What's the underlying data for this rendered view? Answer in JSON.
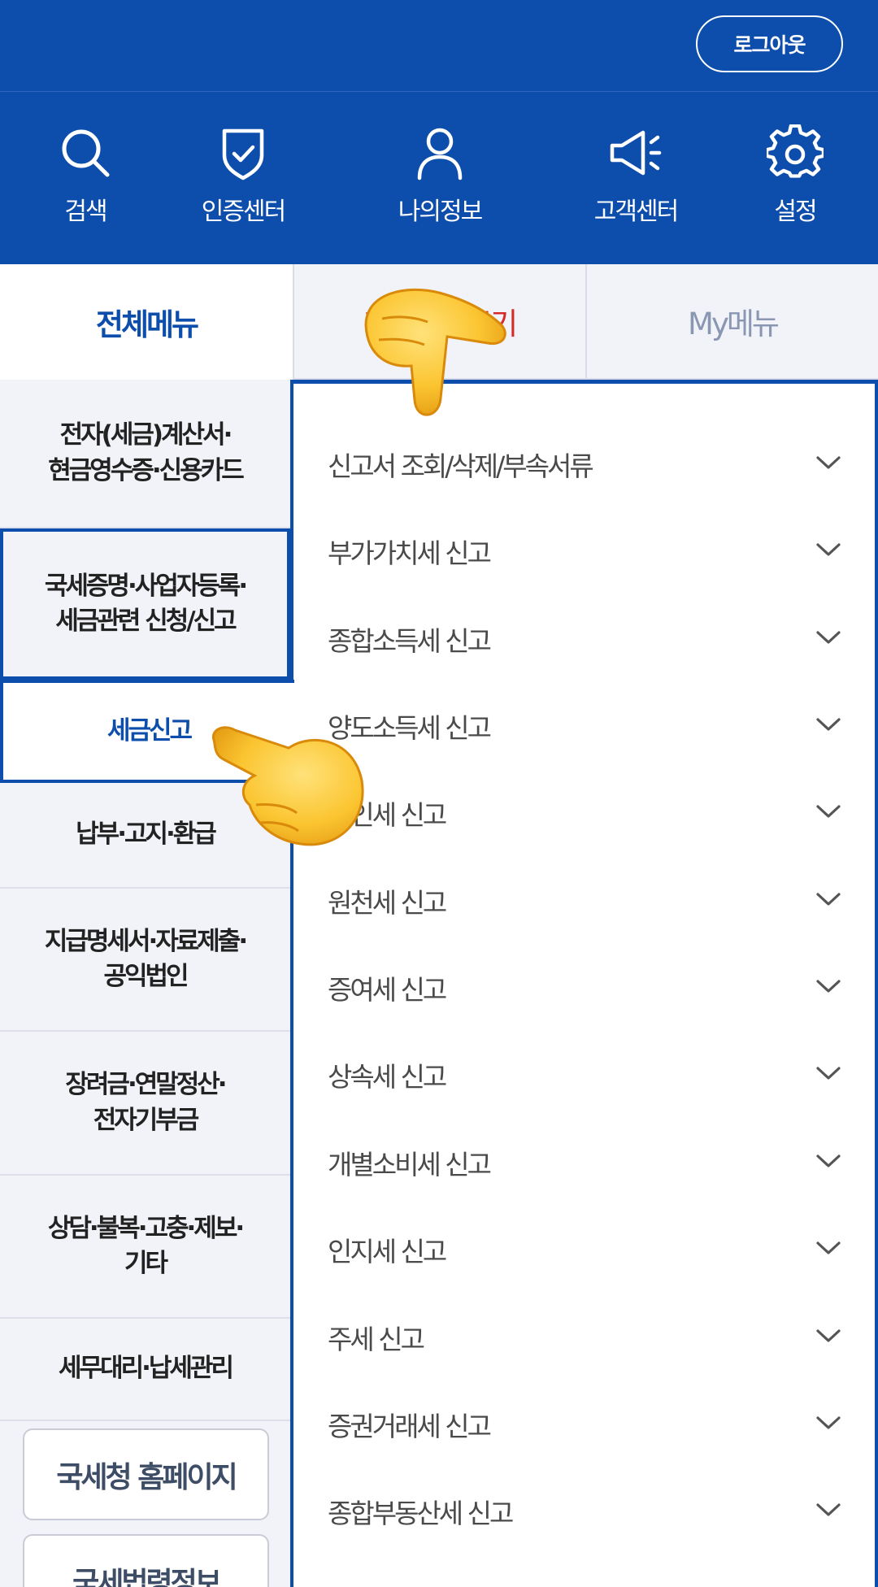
{
  "header": {
    "logout_label": "로그아웃",
    "bg_color": "#0d4eac"
  },
  "icon_nav": [
    {
      "icon": "search-icon",
      "label": "검색"
    },
    {
      "icon": "shield-check-icon",
      "label": "인증센터"
    },
    {
      "icon": "user-icon",
      "label": "나의정보"
    },
    {
      "icon": "megaphone-icon",
      "label": "고객센터"
    },
    {
      "icon": "gear-icon",
      "label": "설정"
    }
  ],
  "tabs": [
    {
      "label": "전체메뉴",
      "state": "active"
    },
    {
      "label": "자주찾는보기",
      "state": "inactive"
    },
    {
      "label": "My메뉴",
      "state": "inactive"
    }
  ],
  "categories": [
    {
      "label": "전자(세금)계산서·\n현금영수증·신용카드"
    },
    {
      "label": "국세증명·사업자등록·\n세금관련 신청/신고"
    },
    {
      "label": "세금신고",
      "active": true
    },
    {
      "label": "납부·고지·환급"
    },
    {
      "label": "지급명세서·자료제출·\n공익법인"
    },
    {
      "label": "장려금·연말정산·\n전자기부금"
    },
    {
      "label": "상담·불복·고충·제보·\n기타"
    },
    {
      "label": "세무대리·납세관리"
    }
  ],
  "side_buttons": [
    {
      "label": "국세청 홈페이지"
    },
    {
      "label": "국세법령정보"
    }
  ],
  "submenu": [
    {
      "label": "신고서 조회/삭제/부속서류"
    },
    {
      "label": "부가가치세 신고"
    },
    {
      "label": "종합소득세 신고"
    },
    {
      "label": "양도소득세 신고"
    },
    {
      "label": "법인세 신고"
    },
    {
      "label": "원천세 신고"
    },
    {
      "label": "증여세 신고"
    },
    {
      "label": "상속세 신고"
    },
    {
      "label": "개별소비세 신고"
    },
    {
      "label": "인지세 신고"
    },
    {
      "label": "주세 신고"
    },
    {
      "label": "증권거래세 신고"
    },
    {
      "label": "종합부동산세 신고"
    }
  ],
  "colors": {
    "accent": "#0d4eac",
    "tab_red": "#d62a2a",
    "tab_gray": "#8a97b3"
  }
}
